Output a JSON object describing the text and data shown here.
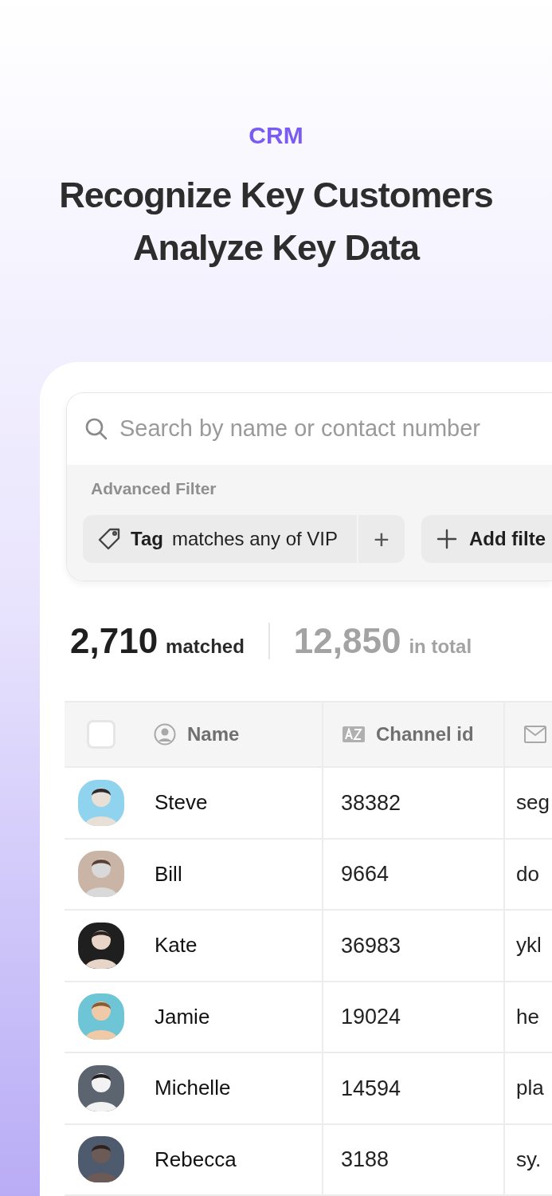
{
  "hero": {
    "eyebrow": "CRM",
    "headline": [
      "Recognize Key Customers",
      "Analyze Key Data"
    ]
  },
  "search": {
    "placeholder": "Search by name or contact number"
  },
  "filter": {
    "title": "Advanced Filter",
    "chips": [
      {
        "field": "Tag",
        "condition": "matches any of VIP"
      }
    ],
    "add_label": "+",
    "add_filter": "Add filte"
  },
  "summary": {
    "matched_count": "2,710",
    "matched_label": "matched",
    "total_count": "12,850",
    "total_label": "in total"
  },
  "table": {
    "select_all": {
      "checked": false
    },
    "columns": [
      "Name",
      "Channel id"
    ],
    "rows": [
      {
        "name": "Steve",
        "channel_id": "38382",
        "column_3": "seg"
      },
      {
        "name": "Bill",
        "channel_id": "9664",
        "column_3": "do"
      },
      {
        "name": "Kate",
        "channel_id": "36983",
        "column_3": "ykl"
      },
      {
        "name": "Jamie",
        "channel_id": "19024",
        "column_3": "he"
      },
      {
        "name": "Michelle",
        "channel_id": "14594",
        "column_3": "pla"
      },
      {
        "name": "Rebecca",
        "channel_id": "3188",
        "column_3": "sy."
      }
    ]
  }
}
